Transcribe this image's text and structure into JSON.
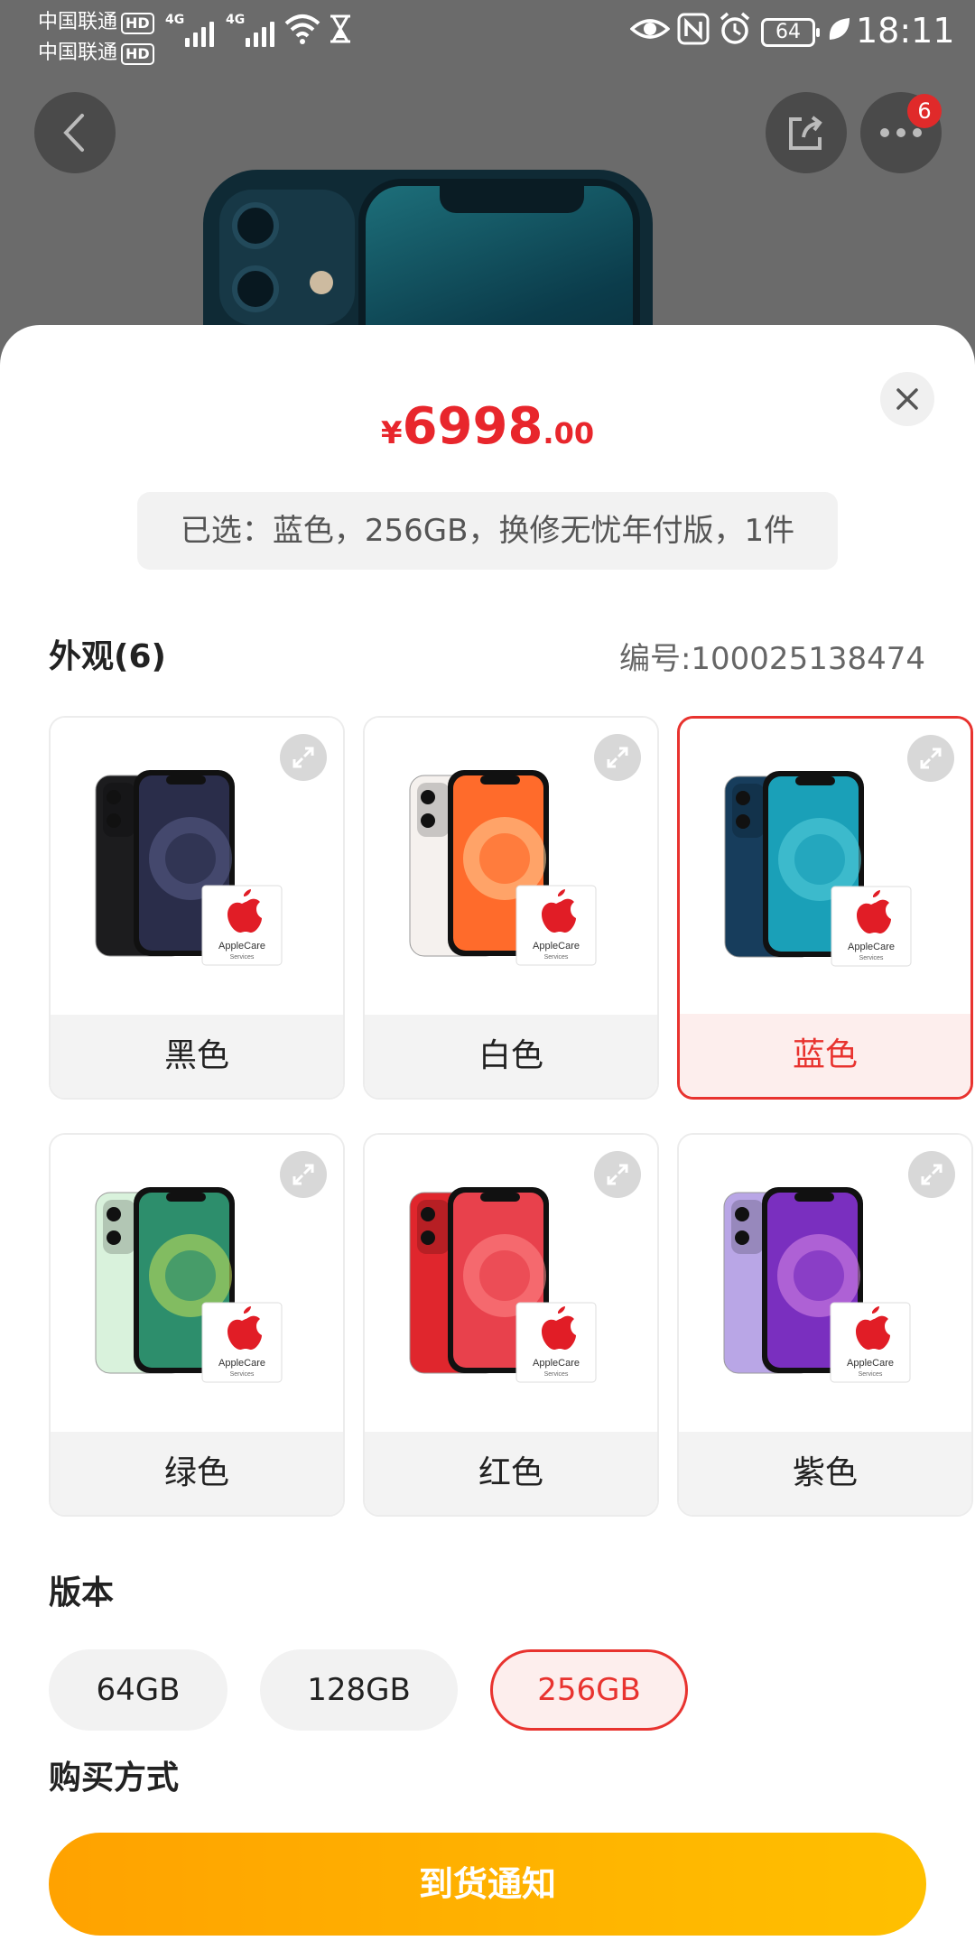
{
  "status_bar": {
    "carrier1": "中国联通",
    "carrier2": "中国联通",
    "hd": "HD",
    "network": "4G",
    "battery": "64",
    "time": "18:11"
  },
  "nav": {
    "more_badge": "6"
  },
  "sheet": {
    "price_currency": "¥",
    "price_integer": "6998",
    "price_decimal": ".00",
    "selected_text": "已选：蓝色，256GB，换修无忧年付版，1件",
    "appearance_title": "外观(6)",
    "sku_text": "编号:100025138474",
    "colors": [
      {
        "label": "黑色",
        "body": "#1c1c1e",
        "screen": "#2a2d4a",
        "accent": "#5a5f8a"
      },
      {
        "label": "白色",
        "body": "#f5f1ee",
        "screen": "#ff6b2b",
        "accent": "#ffd29a"
      },
      {
        "label": "蓝色",
        "body": "#173d5c",
        "screen": "#1aa0b8",
        "accent": "#5ad0dc"
      },
      {
        "label": "绿色",
        "body": "#d9f2dc",
        "screen": "#2d8e6c",
        "accent": "#c8e25a"
      },
      {
        "label": "红色",
        "body": "#e0262d",
        "screen": "#e8414c",
        "accent": "#ff8a8a"
      },
      {
        "label": "紫色",
        "body": "#b9a6e6",
        "screen": "#7a2fbf",
        "accent": "#d88ae8"
      }
    ],
    "applecare_line1": "AppleCare",
    "applecare_line2": "Services",
    "version_title": "版本",
    "versions": [
      "64GB",
      "128GB",
      "256GB"
    ],
    "purchase_title": "购买方式",
    "notify_label": "到货通知"
  },
  "colors": {
    "accent_red": "#e8332f",
    "price_red": "#e8262c",
    "button_orange": "#ffb000"
  }
}
